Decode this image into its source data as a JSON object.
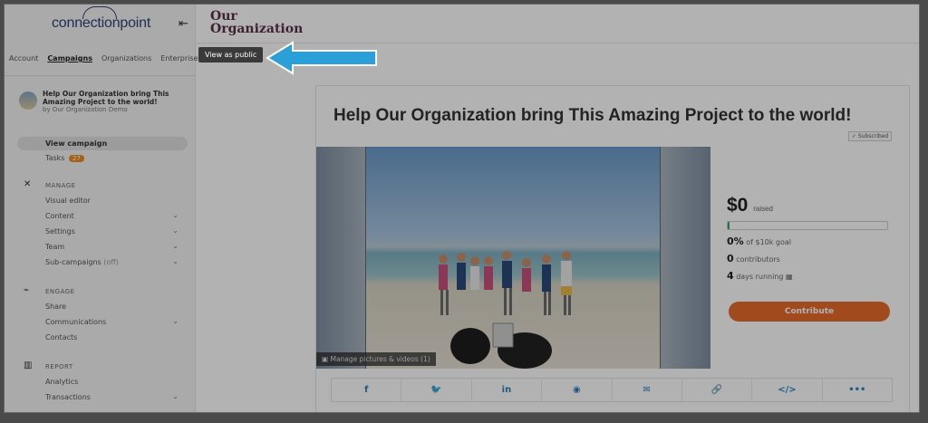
{
  "sidebar": {
    "logo": "connectionpoint",
    "collapse_icon": "collapse-left-icon",
    "tabs": [
      "Account",
      "Campaigns",
      "Organizations",
      "Enterprise"
    ],
    "active_tab": "Campaigns",
    "campaign": {
      "title": "Help Our Organization bring This Amazing Project to the world!",
      "by": "by Our Organization Demo"
    },
    "view_campaign": "View campaign",
    "tasks_label": "Tasks",
    "tasks_count": "27",
    "manage": {
      "heading": "MANAGE",
      "items": [
        "Visual editor",
        "Content",
        "Settings",
        "Team",
        "Sub-campaigns"
      ],
      "sub_off": "(off)"
    },
    "engage": {
      "heading": "ENGAGE",
      "items": [
        "Share",
        "Communications",
        "Contacts"
      ]
    },
    "report": {
      "heading": "REPORT",
      "items": [
        "Analytics",
        "Transactions"
      ]
    }
  },
  "header": {
    "org_line1": "Our",
    "org_line2": "Organization",
    "tooltip": "View as public"
  },
  "main": {
    "title": "Help Our Organization bring This Amazing Project to the world!",
    "subscribed": "✓ Subscribed",
    "manage_pictures": "▣ Manage pictures & videos (1)",
    "amount": "$0",
    "raised": "raised",
    "progress_fraction": 0.0,
    "goal_pct": "0%",
    "goal_text": "of $10k goal",
    "contributors_count": "0",
    "contributors_text": "contributors",
    "days_count": "4",
    "days_text": "days running",
    "contribute": "Contribute",
    "share_icons": [
      "facebook-icon",
      "twitter-icon",
      "linkedin-icon",
      "messenger-icon",
      "email-icon",
      "link-icon",
      "embed-icon",
      "more-icon"
    ],
    "share_glyphs": [
      "f",
      "🐦",
      "in",
      "◉",
      "✉",
      "🔗",
      "</>",
      "•••"
    ]
  },
  "colors": {
    "accent": "#e66a2c",
    "brand": "#2e4374",
    "arrow": "#2a9fd8",
    "org": "#5a2f4a"
  }
}
